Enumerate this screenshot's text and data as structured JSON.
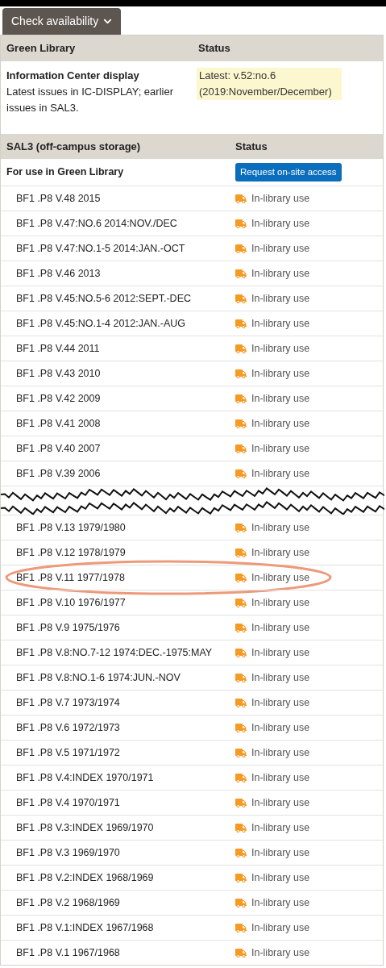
{
  "availability_button": {
    "label": "Check availability",
    "expanded": true
  },
  "green_library": {
    "columns": [
      "Green Library",
      "Status"
    ],
    "location": {
      "name": "Information Center display",
      "note": "Latest issues in IC-DISPLAY; earlier issues in SAL3.",
      "status": "Latest: v.52:no.6 (2019:November/December)"
    }
  },
  "sal3": {
    "columns": [
      "SAL3 (off-campus storage)",
      "Status"
    ],
    "use_note": "For use in Green Library",
    "request_button": "Request on-site access",
    "rows_before_gap": [
      {
        "callnumber": "BF1 .P8 V.48 2015",
        "status": "In-library use",
        "highlighted": false
      },
      {
        "callnumber": "BF1 .P8 V.47:NO.6 2014:NOV./DEC",
        "status": "In-library use",
        "highlighted": false
      },
      {
        "callnumber": "BF1 .P8 V.47:NO.1-5 2014:JAN.-OCT",
        "status": "In-library use",
        "highlighted": false
      },
      {
        "callnumber": "BF1 .P8 V.46 2013",
        "status": "In-library use",
        "highlighted": false
      },
      {
        "callnumber": "BF1 .P8 V.45:NO.5-6 2012:SEPT.-DEC",
        "status": "In-library use",
        "highlighted": false
      },
      {
        "callnumber": "BF1 .P8 V.45:NO.1-4 2012:JAN.-AUG",
        "status": "In-library use",
        "highlighted": false
      },
      {
        "callnumber": "BF1 .P8 V.44 2011",
        "status": "In-library use",
        "highlighted": false
      },
      {
        "callnumber": "BF1 .P8 V.43 2010",
        "status": "In-library use",
        "highlighted": false
      },
      {
        "callnumber": "BF1 .P8 V.42 2009",
        "status": "In-library use",
        "highlighted": false
      },
      {
        "callnumber": "BF1 .P8 V.41 2008",
        "status": "In-library use",
        "highlighted": false
      },
      {
        "callnumber": "BF1 .P8 V.40 2007",
        "status": "In-library use",
        "highlighted": false
      },
      {
        "callnumber": "BF1 .P8 V.39 2006",
        "status": "In-library use",
        "highlighted": false
      }
    ],
    "rows_after_gap": [
      {
        "callnumber": "BF1 .P8 V.13 1979/1980",
        "status": "In-library use",
        "highlighted": false
      },
      {
        "callnumber": "BF1 .P8 V.12 1978/1979",
        "status": "In-library use",
        "highlighted": false
      },
      {
        "callnumber": "BF1 .P8 V.11 1977/1978",
        "status": "In-library use",
        "highlighted": true
      },
      {
        "callnumber": "BF1 .P8 V.10 1976/1977",
        "status": "In-library use",
        "highlighted": false
      },
      {
        "callnumber": "BF1 .P8 V.9 1975/1976",
        "status": "In-library use",
        "highlighted": false
      },
      {
        "callnumber": "BF1 .P8 V.8:NO.7-12 1974:DEC.-1975:MAY",
        "status": "In-library use",
        "highlighted": false
      },
      {
        "callnumber": "BF1 .P8 V.8:NO.1-6 1974:JUN.-NOV",
        "status": "In-library use",
        "highlighted": false
      },
      {
        "callnumber": "BF1 .P8 V.7 1973/1974",
        "status": "In-library use",
        "highlighted": false
      },
      {
        "callnumber": "BF1 .P8 V.6 1972/1973",
        "status": "In-library use",
        "highlighted": false
      },
      {
        "callnumber": "BF1 .P8 V.5 1971/1972",
        "status": "In-library use",
        "highlighted": false
      },
      {
        "callnumber": "BF1 .P8 V.4:INDEX 1970/1971",
        "status": "In-library use",
        "highlighted": false
      },
      {
        "callnumber": "BF1 .P8 V.4 1970/1971",
        "status": "In-library use",
        "highlighted": false
      },
      {
        "callnumber": "BF1 .P8 V.3:INDEX 1969/1970",
        "status": "In-library use",
        "highlighted": false
      },
      {
        "callnumber": "BF1 .P8 V.3 1969/1970",
        "status": "In-library use",
        "highlighted": false
      },
      {
        "callnumber": "BF1 .P8 V.2:INDEX 1968/1969",
        "status": "In-library use",
        "highlighted": false
      },
      {
        "callnumber": "BF1 .P8 V.2 1968/1969",
        "status": "In-library use",
        "highlighted": false
      },
      {
        "callnumber": "BF1 .P8 V.1:INDEX 1967/1968",
        "status": "In-library use",
        "highlighted": false
      },
      {
        "callnumber": "BF1 .P8 V.1 1967/1968",
        "status": "In-library use",
        "highlighted": false
      }
    ]
  }
}
